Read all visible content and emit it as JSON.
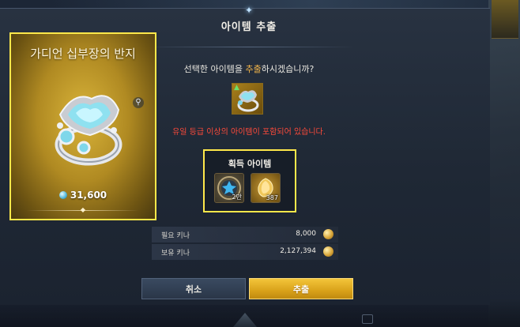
{
  "dialog": {
    "title": "아이템 추출",
    "question_prefix": "선택한 아이템을 ",
    "question_highlight": "추출",
    "question_suffix": "하시겠습니까?",
    "warning": "유일 등급 이상의 아이템이 포함되어 있습니다."
  },
  "item_card": {
    "name": "가디언 십부장의 반지",
    "price": "31,600",
    "price_icon": "gem-icon",
    "zoom_icon": "magnifier-icon"
  },
  "reward": {
    "title": "획득 아이템",
    "items": [
      {
        "icon": "blue-emblem-icon",
        "count": "2만"
      },
      {
        "icon": "gold-shard-icon",
        "count": "387"
      }
    ]
  },
  "costs": [
    {
      "label": "필요 키나",
      "value": "8,000",
      "icon": "kinah-coin-icon"
    },
    {
      "label": "보유 키나",
      "value": "2,127,394",
      "icon": "kinah-coin-icon"
    }
  ],
  "buttons": {
    "cancel": "취소",
    "extract": "추출"
  },
  "colors": {
    "highlight_border": "#ffe84a",
    "accent_orange": "#f2b54a",
    "warning_red": "#ff4a3a",
    "confirm_gold": "#e0aa22"
  }
}
